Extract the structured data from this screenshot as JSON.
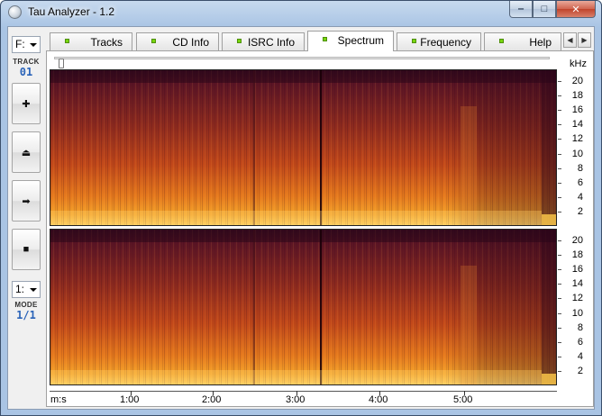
{
  "window": {
    "title": "Tau Analyzer - 1.2",
    "buttons": {
      "minimize": "‒",
      "maximize": "□",
      "close": "✕"
    }
  },
  "toolbar": {
    "drive": "F:",
    "track_caption": "TRACK",
    "track_value": "01",
    "buttons": [
      {
        "name": "add",
        "glyph": "✚"
      },
      {
        "name": "eject",
        "glyph": "⏏"
      },
      {
        "name": "play",
        "glyph": "➡"
      },
      {
        "name": "stop",
        "glyph": "■"
      }
    ],
    "mode_select": "1:",
    "mode_caption": "MODE",
    "mode_value": "1/1"
  },
  "tabs": [
    {
      "label": "Tracks",
      "active": false
    },
    {
      "label": "CD Info",
      "active": false
    },
    {
      "label": "ISRC Info",
      "active": false
    },
    {
      "label": "Spectrum",
      "active": true
    },
    {
      "label": "Frequency",
      "active": false
    },
    {
      "label": "Help",
      "active": false
    }
  ],
  "spectrum": {
    "unit": "kHz",
    "freq_ticks": [
      "20",
      "18",
      "16",
      "14",
      "12",
      "10",
      "8",
      "6",
      "4",
      "2"
    ],
    "time_ticks": [
      "m:s",
      "1:00",
      "2:00",
      "3:00",
      "4:00",
      "5:00"
    ],
    "channels": 2,
    "colors": {
      "low": "#3a0e22",
      "mid": "#b8411a",
      "high": "#f3a12a",
      "peak": "#ffd86a"
    }
  }
}
